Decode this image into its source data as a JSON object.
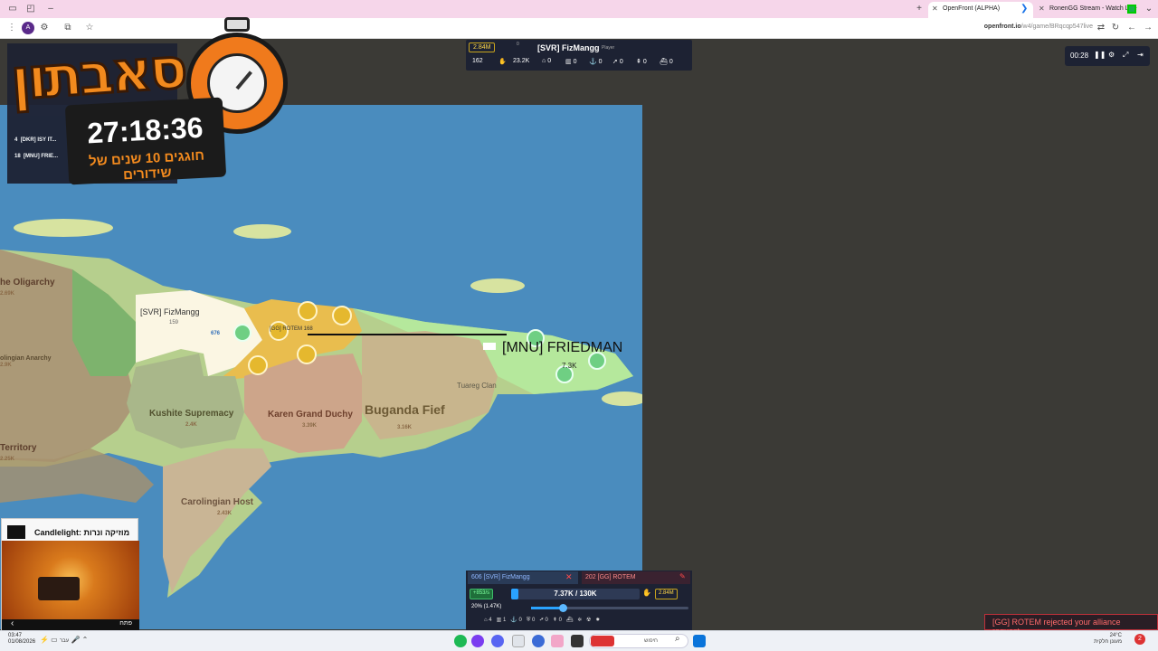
{
  "browser": {
    "tabs": [
      {
        "label": "OpenFront (ALPHA)",
        "active": true
      },
      {
        "label": "RonenGG Stream - Watch Live",
        "active": false
      }
    ],
    "url_host": "openfront.io",
    "url_path": "/w4/game/BRqcqp547live"
  },
  "player_panel": {
    "gold": "2.84M",
    "troops_small_label": "0",
    "name": "[SVR] FizMangg",
    "role": "Player",
    "tiles": "162",
    "troops": "23.2K",
    "counts": [
      "0",
      "0",
      "0",
      "0",
      "0",
      "0"
    ]
  },
  "top_controls": {
    "elapsed": "00:28"
  },
  "leaderboard": {
    "rows": [
      {
        "rank": "4",
        "name": "[DKR] ISY IT..."
      },
      {
        "rank": "18",
        "name": "[MNU] FRIE..."
      }
    ]
  },
  "overlay": {
    "title": "סאבתון",
    "countdown": "27:18:36",
    "subtitle": "חוגגים 10 שנים של שידורים"
  },
  "map": {
    "labels": [
      {
        "name": "he Oligarchy",
        "value": "2.69K"
      },
      {
        "name": "[SVR] FizMangg",
        "value": "159"
      },
      {
        "name": "[GG] ROTEM",
        "value": "168"
      },
      {
        "name": "[MNU] FRIEDMAN",
        "value": "7.3K"
      },
      {
        "name": "olingian Anarchy",
        "value": "2.9K"
      },
      {
        "name": "Kushite Supremacy",
        "value": "2.4K"
      },
      {
        "name": "Karen Grand Duchy",
        "value": "3.39K"
      },
      {
        "name": "Buganda Fief",
        "value": "3.16K"
      },
      {
        "name": "Tuareg Clan",
        "value": ""
      },
      {
        "name": "Territory",
        "value": "2.25K"
      },
      {
        "name": "Carolingian Host",
        "value": "2.43K"
      }
    ],
    "attack_count": "676"
  },
  "bottom_card": {
    "player_left": "606  [SVR] FizMangg",
    "player_right": "202  [GG] ROTEM",
    "rate": "+853/s",
    "population": "7.37K / 130K",
    "population_fraction": 0.057,
    "gold": "2.84M",
    "attack_ratio": "20% (1.47K)",
    "attack_ratio_fraction": 0.2,
    "counts": [
      "4",
      "1",
      "0",
      "0",
      "0",
      "0"
    ]
  },
  "media": {
    "title": "Candlelight: מוזיקה ונרות",
    "action": "פתח"
  },
  "notification": "[GG] ROTEM rejected your alliance request",
  "taskbar": {
    "time": "03:47",
    "date": "01/08/2026",
    "lang": "עבר",
    "search": "חיפוש",
    "temp": "24°C",
    "weather": "מעונן חלקית",
    "badge": "2"
  }
}
